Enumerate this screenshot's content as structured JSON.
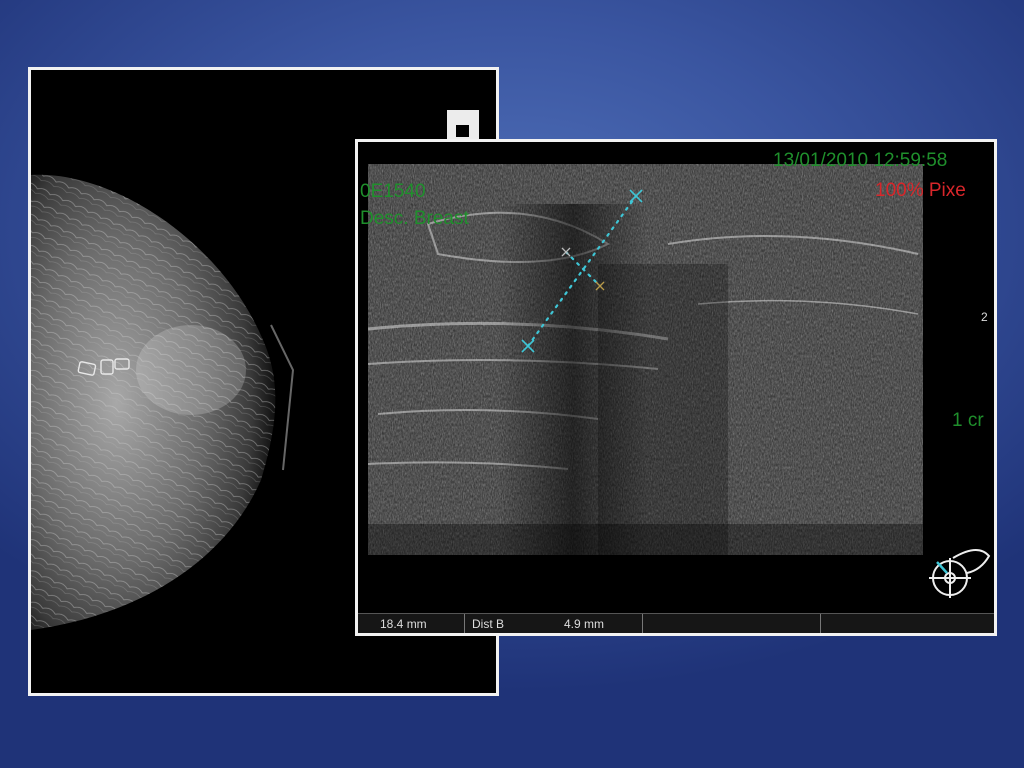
{
  "ultrasound": {
    "datetime": "13/01/2010 12:59:58",
    "patient_id": "0E1540",
    "description": "Desc. Breast",
    "zoom_label": "100% Pixe",
    "depth_label": "1 cr",
    "side_number": "2",
    "measurement_a": "18.4 mm",
    "measurement_b_label": "Dist B",
    "measurement_b_value": "4.9 mm"
  },
  "colors": {
    "background": "#3a55a0",
    "overlay_green": "#1f8f2c",
    "overlay_red": "#d8262a",
    "caliper": "#3fc6d6"
  }
}
